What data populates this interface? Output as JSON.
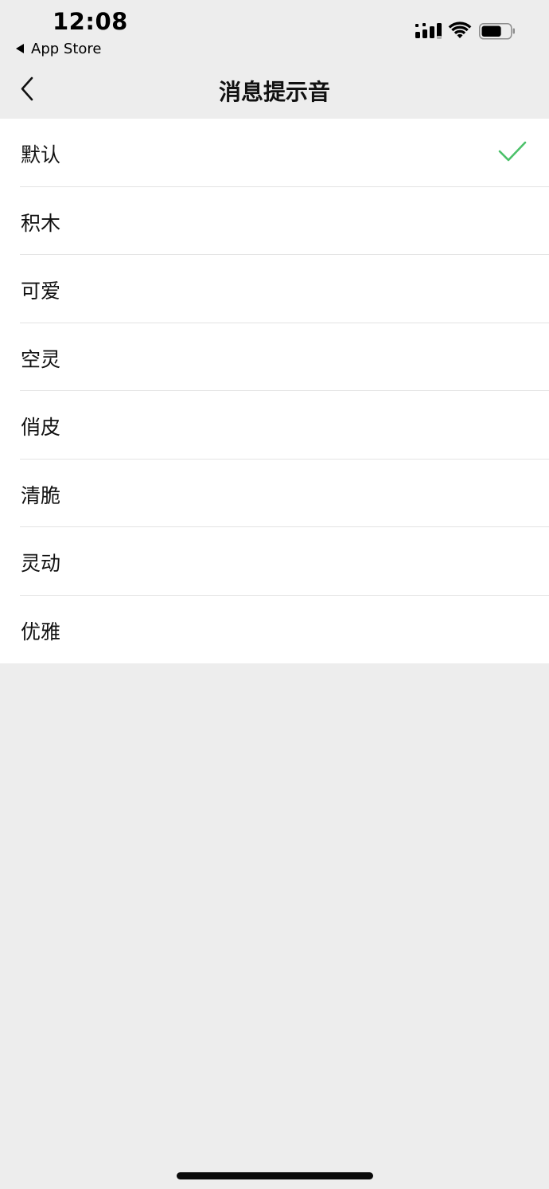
{
  "status_bar": {
    "time": "12:08",
    "back_app_label": "App Store",
    "icons": [
      "signal-icon",
      "wifi-icon",
      "battery-icon"
    ],
    "battery_level_percent": 70
  },
  "nav": {
    "title": "消息提示音",
    "back_icon": "chevron-left-icon"
  },
  "sounds": {
    "items": [
      {
        "label": "默认",
        "selected": true
      },
      {
        "label": "积木",
        "selected": false
      },
      {
        "label": "可爱",
        "selected": false
      },
      {
        "label": "空灵",
        "selected": false
      },
      {
        "label": "俏皮",
        "selected": false
      },
      {
        "label": "清脆",
        "selected": false
      },
      {
        "label": "灵动",
        "selected": false
      },
      {
        "label": "优雅",
        "selected": false
      }
    ],
    "check_color": "#4cc16a"
  },
  "colors": {
    "background": "#ededed",
    "list_background": "#ffffff",
    "text": "#111111",
    "divider": "#e3e3e3"
  }
}
